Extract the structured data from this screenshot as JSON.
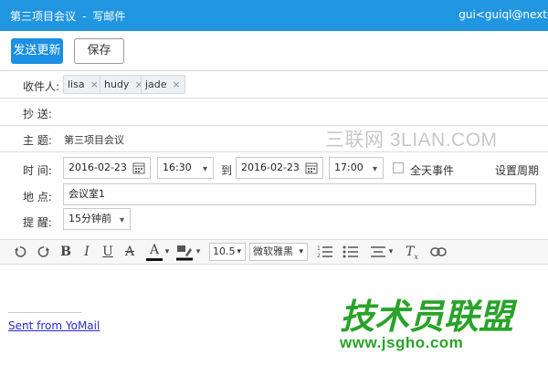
{
  "titlebar": {
    "subject": "第三项目会议",
    "separator": "-",
    "mode": "写邮件",
    "account": "gui<guiql@nexted"
  },
  "actions": {
    "send_label": "发送更新",
    "save_label": "保存"
  },
  "recipients": {
    "label": "收件人:",
    "chips": [
      "lisa",
      "hudy",
      "jade"
    ],
    "remove_glyph": "×"
  },
  "cc": {
    "label": "抄  送:"
  },
  "subject": {
    "label": "主  题:",
    "value": "第三项目会议"
  },
  "watermark_top": "三联网 3LIAN.COM",
  "time": {
    "label": "时  间:",
    "start_date": "2016-02-23",
    "start_time": "16:30",
    "to_label": "到",
    "end_date": "2016-02-23",
    "end_time": "17:00",
    "all_day_label": "全天事件",
    "recurrence_label": "设置周期"
  },
  "location": {
    "label": "地  点:",
    "value": "会议室1"
  },
  "reminder": {
    "label": "提  醒:",
    "value": "15分钟前"
  },
  "toolbar": {
    "font_size": "10.5",
    "font_family": "微软雅黑",
    "bold": "B",
    "italic": "I",
    "underline": "U",
    "strike": "A",
    "font_color": "A",
    "clear_format": "T"
  },
  "body": {
    "signature_link": "Sent from YoMail"
  },
  "watermark_logo": {
    "text": "技术员联盟",
    "url": "www.jsgho.com"
  },
  "colors": {
    "titlebar": "#2196e0",
    "primary_button": "#1a8fe3",
    "logo_green": "#29a329"
  }
}
